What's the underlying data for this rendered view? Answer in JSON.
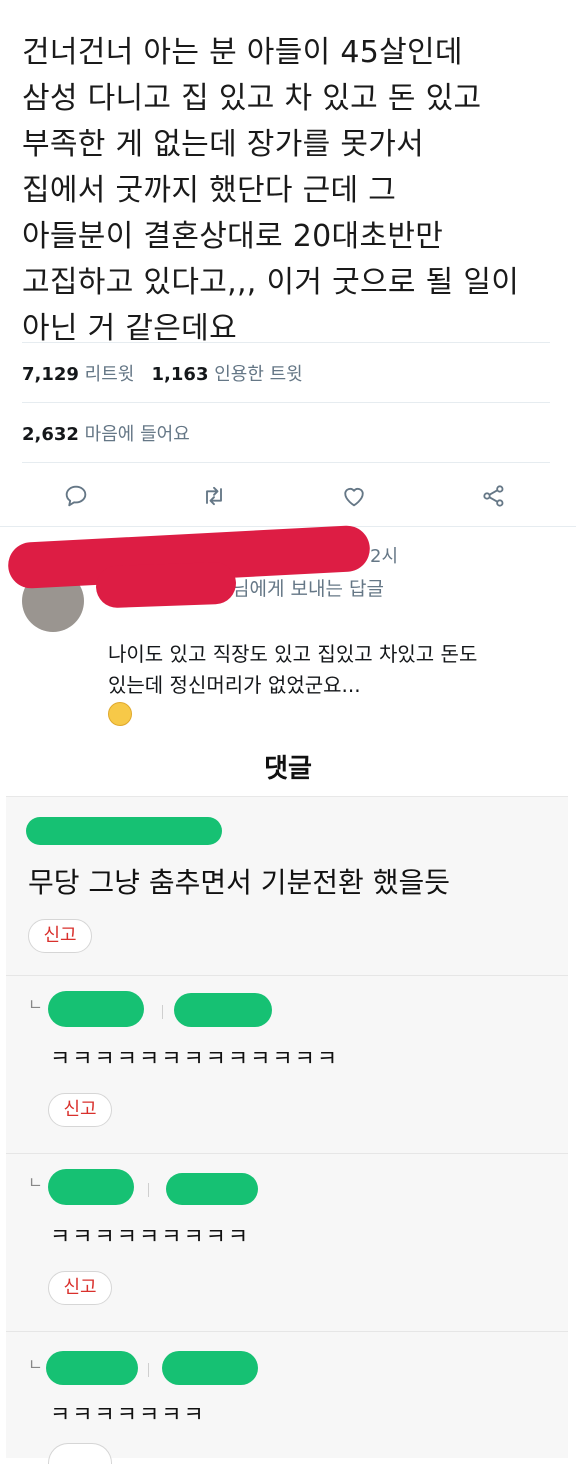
{
  "tweet": {
    "text": "건너건너 아는 분 아들이 45살인데\n삼성 다니고 집 있고 차 있고 돈 있고\n부족한 게 없는데 장가를 못가서\n집에서 굿까지 했단다 근데 그\n아들분이 결혼상대로 20대초반만\n고집하고 있다고,,, 이거 굿으로 될 일이\n아닌 거 같은데요",
    "retweets_count": "7,129",
    "retweets_label": "리트윗",
    "quotes_count": "1,163",
    "quotes_label": "인용한 트윗",
    "likes_count": "2,632",
    "likes_label": "마음에 들어요",
    "actions": [
      "reply-icon",
      "retweet-icon",
      "heart-icon",
      "share-icon"
    ]
  },
  "reply": {
    "time_fragment": "2시",
    "reply_to": "님에게 보내는 답글",
    "body": "나이도 있고 직장도 있고 집있고 차있고 돈도\n있는데 정신머리가 없었군요...",
    "emoji": "smiling-face-with-halo"
  },
  "comments_section": {
    "title": "댓글",
    "report_label": "신고",
    "reply_marker": "ㄴ",
    "items": [
      {
        "text": "무당 그냥 춤추면서 기분전환 했을듯"
      },
      {
        "text": "ㅋㅋㅋㅋㅋㅋㅋㅋㅋㅋㅋㅋㅋ"
      },
      {
        "text": "ㅋㅋㅋㅋㅋㅋㅋㅋㅋ"
      },
      {
        "text": "ㅋㅋㅋㅋㅋㅋㅋ"
      }
    ]
  },
  "colors": {
    "redaction_red": "#dd1d44",
    "redaction_green": "#16c173",
    "report_text": "#d9302c"
  }
}
